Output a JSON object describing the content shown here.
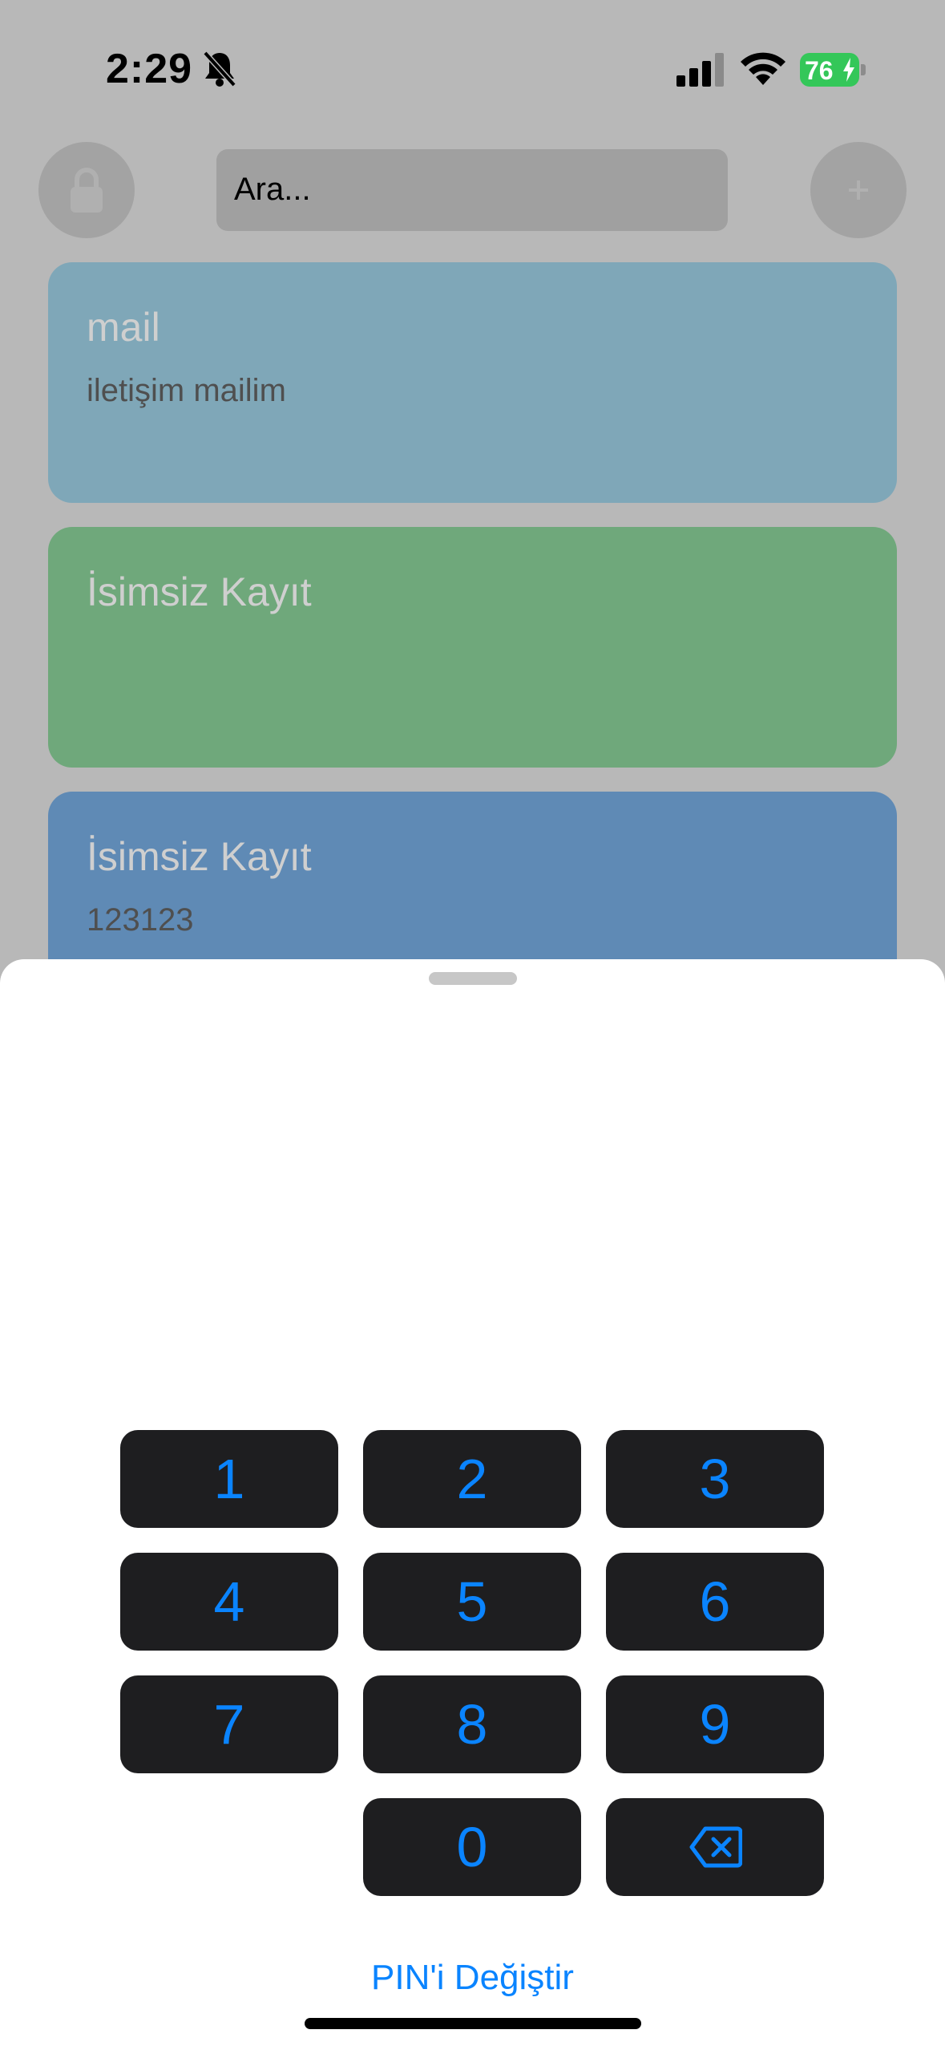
{
  "status_bar": {
    "time": "2:29",
    "battery": "76",
    "icons": [
      "bell-slash-icon",
      "cellular-signal-icon",
      "wifi-icon",
      "battery-charging-icon"
    ]
  },
  "header": {
    "search_placeholder": "Ara...",
    "left_button_icon": "lock-icon",
    "right_button_icon": "plus-icon"
  },
  "cards": [
    {
      "title": "mail",
      "subtitle": "iletişim mailim",
      "color": "#7fa7b8"
    },
    {
      "title": "İsimsiz Kayıt",
      "subtitle": "",
      "color": "#6fa87b"
    },
    {
      "title": "İsimsiz Kayıt",
      "subtitle": "123123",
      "color": "#5f8ab5"
    }
  ],
  "pin_sheet": {
    "keys": [
      "1",
      "2",
      "3",
      "4",
      "5",
      "6",
      "7",
      "8",
      "9",
      "0"
    ],
    "delete_icon": "delete-backspace-icon",
    "change_pin_label": "PIN'i Değiştir"
  },
  "colors": {
    "accent": "#0a84ff",
    "key_background": "#1e1e20",
    "overlay_background": "#b8b8b8",
    "battery": "#34c759"
  }
}
